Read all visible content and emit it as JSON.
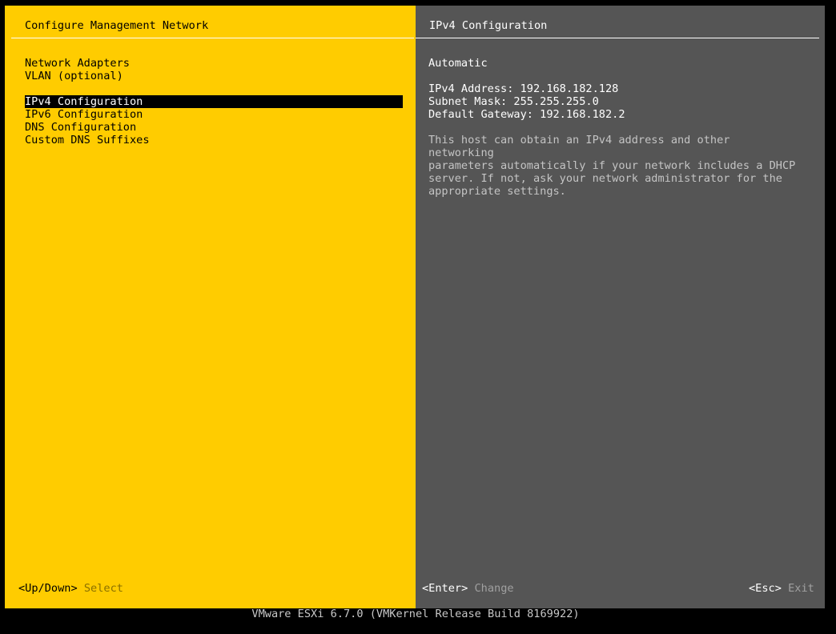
{
  "left_pane": {
    "title": "Configure Management Network",
    "menu": [
      {
        "label": "Network Adapters"
      },
      {
        "label": "VLAN (optional)"
      },
      {
        "label": "IPv4 Configuration",
        "selected": true
      },
      {
        "label": "IPv6 Configuration"
      },
      {
        "label": "DNS Configuration"
      },
      {
        "label": "Custom DNS Suffixes"
      }
    ]
  },
  "right_pane": {
    "title": "IPv4 Configuration",
    "mode": "Automatic",
    "ipv4_address": "IPv4 Address: 192.168.182.128",
    "subnet_mask": "Subnet Mask: 255.255.255.0",
    "default_gateway": "Default Gateway: 192.168.182.2",
    "help_text": "This host can obtain an IPv4 address and other networking\nparameters automatically if your network includes a DHCP\nserver. If not, ask your network administrator for the\nappropriate settings."
  },
  "footer": {
    "updown_key": "<Up/Down>",
    "updown_action": "Select",
    "enter_key": "<Enter>",
    "enter_action": "Change",
    "esc_key": "<Esc>",
    "esc_action": "Exit"
  },
  "status_bar": "VMware ESXi 6.7.0 (VMKernel Release Build 8169922)",
  "colors": {
    "left_bg": "#ffcc00",
    "right_bg": "#555555",
    "selection_bg": "#000000"
  }
}
